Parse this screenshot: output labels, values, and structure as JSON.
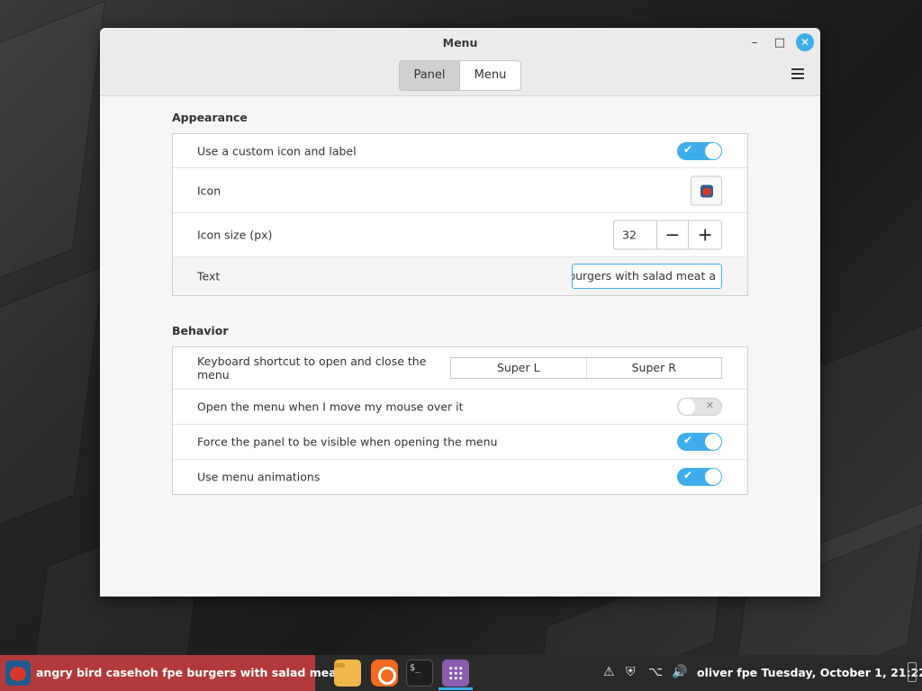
{
  "window": {
    "title": "Menu",
    "minimize_glyph": "–",
    "maximize_glyph": "□",
    "close_glyph": "✕"
  },
  "tabs": [
    {
      "label": "Panel",
      "active": true
    },
    {
      "label": "Menu",
      "active": false
    }
  ],
  "appearance": {
    "title": "Appearance",
    "rows": {
      "custom_icon": {
        "label": "Use a custom icon and label",
        "value": true
      },
      "icon": {
        "label": "Icon"
      },
      "icon_size": {
        "label": "Icon size (px)",
        "value": "32",
        "minus": "−",
        "plus": "+"
      },
      "text": {
        "label": "Text",
        "value": "angry bird casehoh fpe burgers with salad meat a"
      }
    }
  },
  "behavior": {
    "title": "Behavior",
    "rows": {
      "shortcut": {
        "label": "Keyboard shortcut to open and close the menu",
        "key1": "Super L",
        "key2": "Super R"
      },
      "hover_open": {
        "label": "Open the menu when I move my mouse over it",
        "value": false
      },
      "force_panel": {
        "label": "Force the panel to be visible when opening the menu",
        "value": true
      },
      "animations": {
        "label": "Use menu animations",
        "value": true
      }
    }
  },
  "toggle_glyphs": {
    "on": "✔",
    "off": "✕"
  },
  "taskbar": {
    "window_title": "angry bird casehoh fpe burgers with salad meat a",
    "terminal_glyph": "$_",
    "status": "oliver fpe Tuesday, October  1, 21:22"
  },
  "colors": {
    "accent": "#3daee9",
    "taskbar_active": "#b33a3a"
  }
}
